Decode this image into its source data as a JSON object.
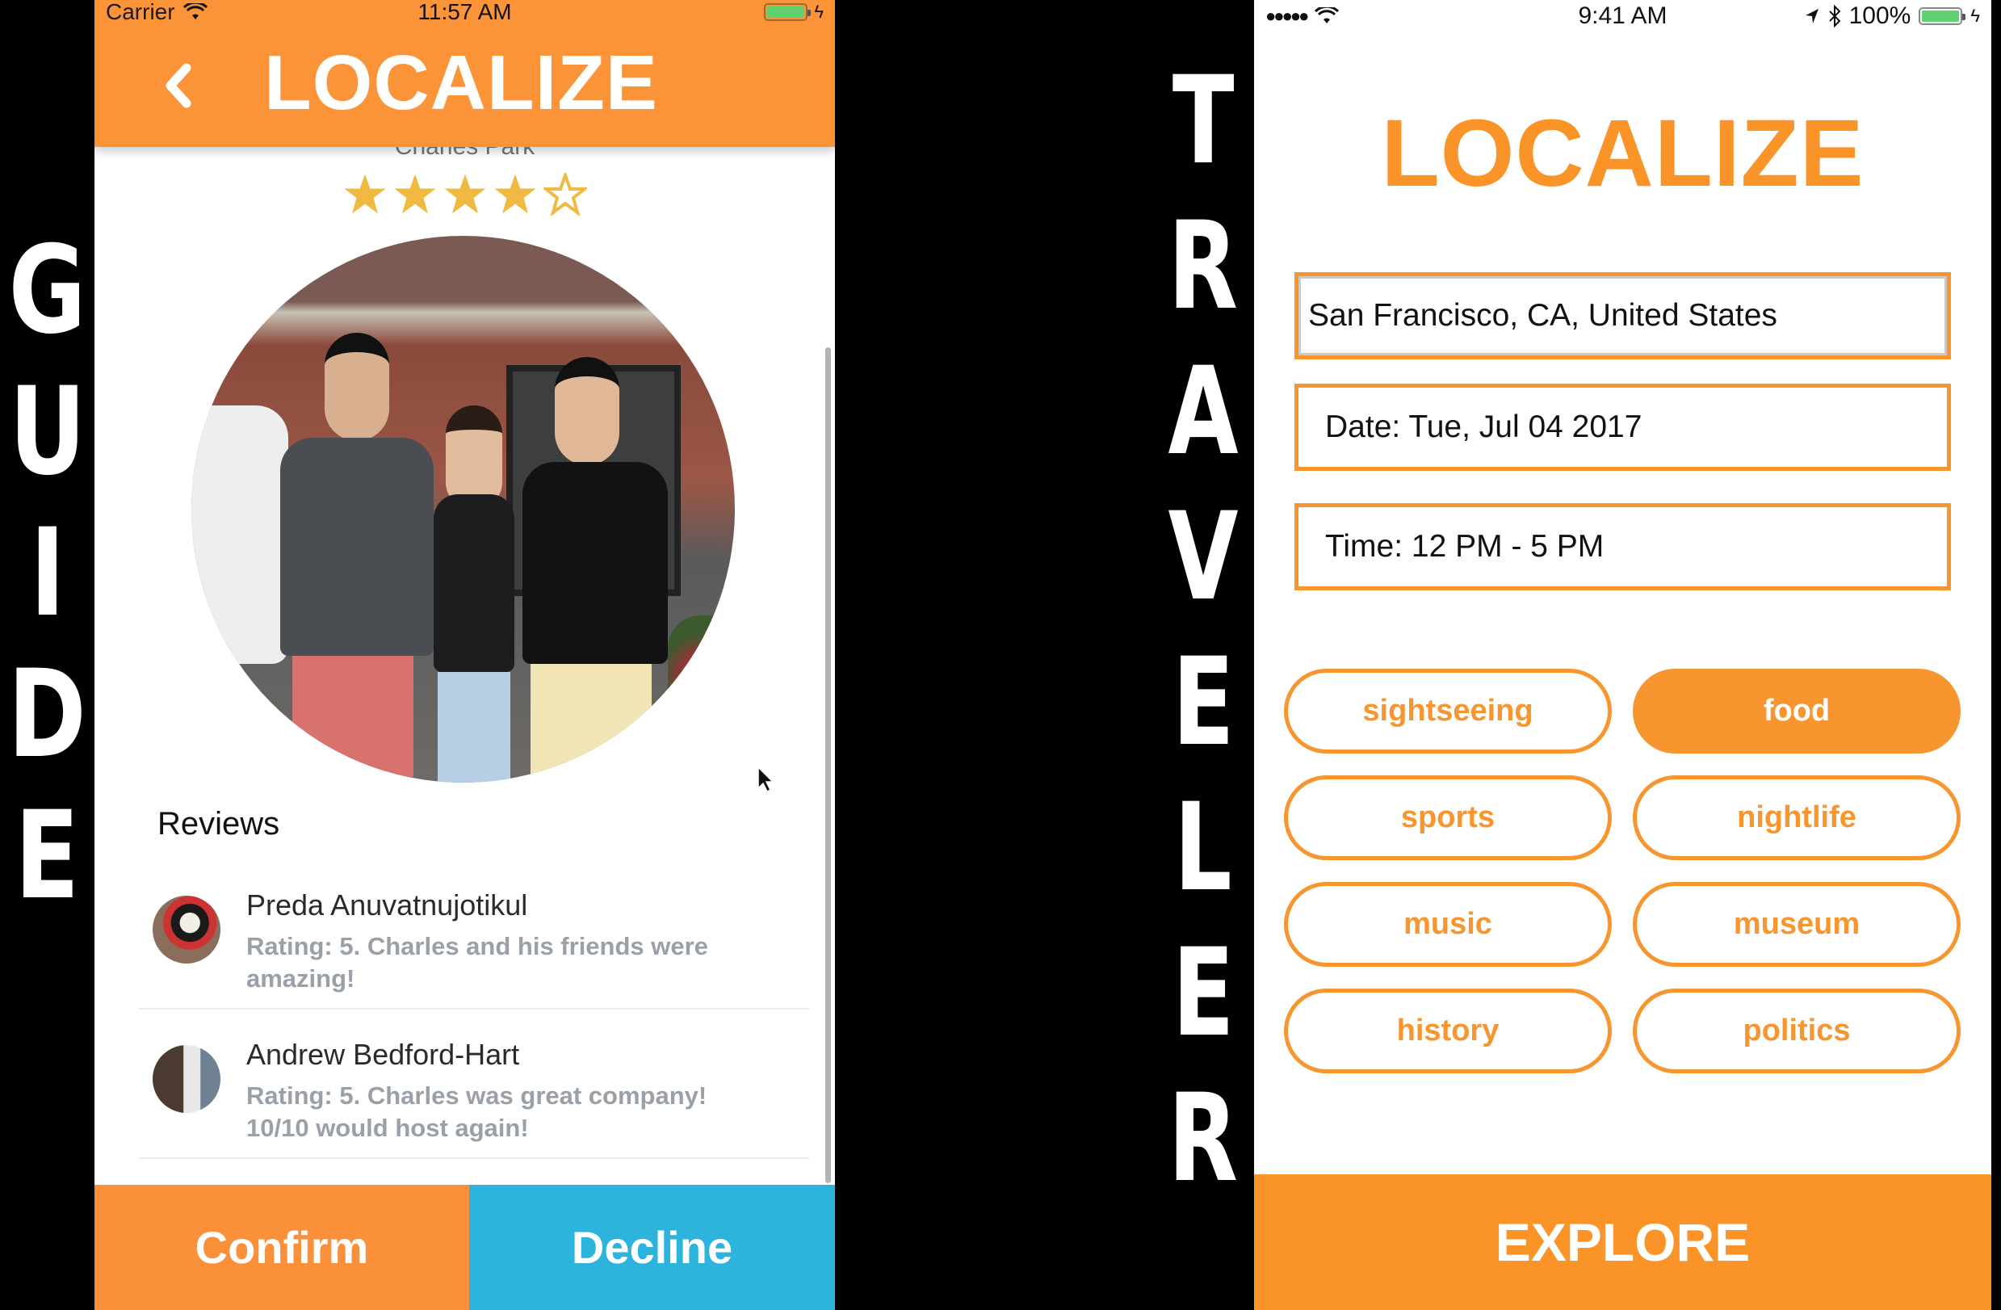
{
  "labels": {
    "left_word": [
      "G",
      "U",
      "I",
      "D",
      "E"
    ],
    "right_word": [
      "T",
      "R",
      "A",
      "V",
      "E",
      "L",
      "E",
      "R"
    ]
  },
  "guide_screen": {
    "status_bar": {
      "carrier": "Carrier",
      "time": "11:57 AM",
      "battery_level": "100%"
    },
    "header": {
      "title": "LOCALIZE",
      "back_icon": "chevron-left-icon"
    },
    "profile": {
      "name_partially_hidden": "Charles Park",
      "rating": 4,
      "rating_max": 5,
      "photo": "group-photo"
    },
    "reviews": {
      "title": "Reviews",
      "items": [
        {
          "name": "Preda Anuvatnujotikul",
          "text": "Rating: 5. Charles and his friends were amazing!"
        },
        {
          "name": "Andrew Bedford-Hart",
          "text": "Rating: 5. Charles was great company! 10/10 would host again!"
        }
      ]
    },
    "actions": {
      "confirm_label": "Confirm",
      "decline_label": "Decline"
    }
  },
  "traveler_screen": {
    "status_bar": {
      "signal": "●●●●●",
      "time": "9:41 AM",
      "battery_percent": "100%"
    },
    "title": "LOCALIZE",
    "fields": {
      "location": "San Francisco, CA, United States",
      "date": "Date: Tue, Jul 04 2017",
      "time": "Time: 12 PM - 5 PM"
    },
    "categories": [
      {
        "label": "sightseeing",
        "selected": false
      },
      {
        "label": "food",
        "selected": true
      },
      {
        "label": "sports",
        "selected": false
      },
      {
        "label": "nightlife",
        "selected": false
      },
      {
        "label": "music",
        "selected": false
      },
      {
        "label": "museum",
        "selected": false
      },
      {
        "label": "history",
        "selected": false
      },
      {
        "label": "politics",
        "selected": false
      }
    ],
    "explore_label": "EXPLORE"
  },
  "colors": {
    "brand_orange": "#fb9428",
    "decline_blue": "#2cb4dc",
    "star_gold": "#f0b942",
    "review_text_gray": "#99a0a8"
  }
}
